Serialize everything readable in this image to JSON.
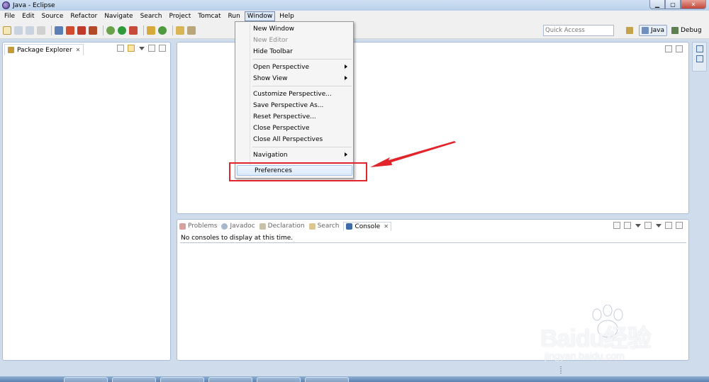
{
  "window": {
    "title": "Java - Eclipse"
  },
  "menubar": [
    "File",
    "Edit",
    "Source",
    "Refactor",
    "Navigate",
    "Search",
    "Project",
    "Tomcat",
    "Run",
    "Window",
    "Help"
  ],
  "toolbar": {
    "quick_access_placeholder": "Quick Access",
    "perspectives": [
      {
        "label": "Java",
        "active": true
      },
      {
        "label": "Debug",
        "active": false
      }
    ]
  },
  "package_explorer": {
    "title": "Package Explorer"
  },
  "window_menu": [
    {
      "label": "New Window",
      "disabled": false,
      "submenu": false
    },
    {
      "label": "New Editor",
      "disabled": true,
      "submenu": false
    },
    {
      "label": "Hide Toolbar",
      "disabled": false,
      "submenu": false
    },
    {
      "label": "Open Perspective",
      "disabled": false,
      "submenu": true
    },
    {
      "label": "Show View",
      "disabled": false,
      "submenu": true
    },
    {
      "label": "Customize Perspective...",
      "disabled": false,
      "submenu": false
    },
    {
      "label": "Save Perspective As...",
      "disabled": false,
      "submenu": false
    },
    {
      "label": "Reset Perspective...",
      "disabled": false,
      "submenu": false
    },
    {
      "label": "Close Perspective",
      "disabled": false,
      "submenu": false
    },
    {
      "label": "Close All Perspectives",
      "disabled": false,
      "submenu": false
    },
    {
      "label": "Navigation",
      "disabled": false,
      "submenu": true
    },
    {
      "label": "Preferences",
      "disabled": false,
      "submenu": false,
      "highlighted": true
    }
  ],
  "bottom_tabs": [
    "Problems",
    "Javadoc",
    "Declaration",
    "Search",
    "Console"
  ],
  "console": {
    "message": "No consoles to display at this time."
  },
  "watermark": {
    "main": "Baidu经验",
    "sub": "jingyan.baidu.com"
  },
  "colors": {
    "annotation": "#e2242b",
    "accent": "#4a6fa0"
  }
}
